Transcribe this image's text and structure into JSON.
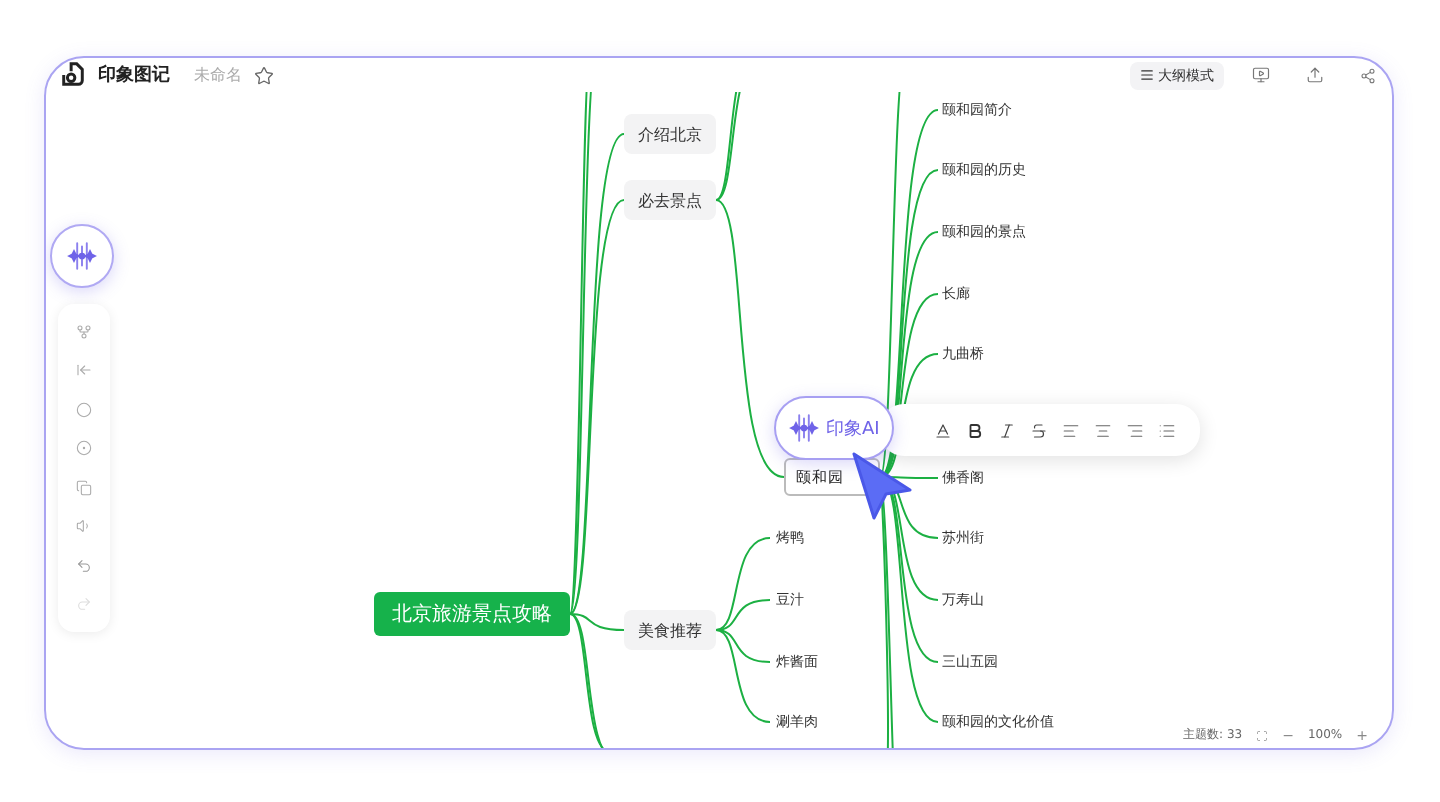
{
  "app": {
    "name": "印象图记",
    "doc_title": "未命名"
  },
  "toolbar": {
    "outline_button": "大纲模式"
  },
  "mindmap": {
    "root": "北京旅游景点攻略",
    "branches": [
      {
        "label": "介绍北京"
      },
      {
        "label": "必去景点",
        "children": [
          {
            "label": "颐和园",
            "kind": "editing",
            "children": [
              {
                "label": "颐和园简介"
              },
              {
                "label": "颐和园的历史"
              },
              {
                "label": "颐和园的景点"
              },
              {
                "label": "长廊"
              },
              {
                "label": "九曲桥"
              },
              {
                "label": "佛香阁"
              },
              {
                "label": "苏州街"
              },
              {
                "label": "万寿山"
              },
              {
                "label": "三山五园"
              },
              {
                "label": "颐和园的文化价值"
              }
            ]
          }
        ]
      },
      {
        "label": "美食推荐",
        "children": [
          {
            "label": "烤鸭",
            "kind": "leaf"
          },
          {
            "label": "豆汁",
            "kind": "leaf"
          },
          {
            "label": "炸酱面",
            "kind": "leaf"
          },
          {
            "label": "涮羊肉",
            "kind": "leaf"
          }
        ]
      }
    ]
  },
  "ai_button": {
    "label": "印象AI"
  },
  "status": {
    "topic_count": "主题数: 33",
    "zoom_out": "−",
    "zoom": "100%",
    "zoom_in": "+"
  }
}
